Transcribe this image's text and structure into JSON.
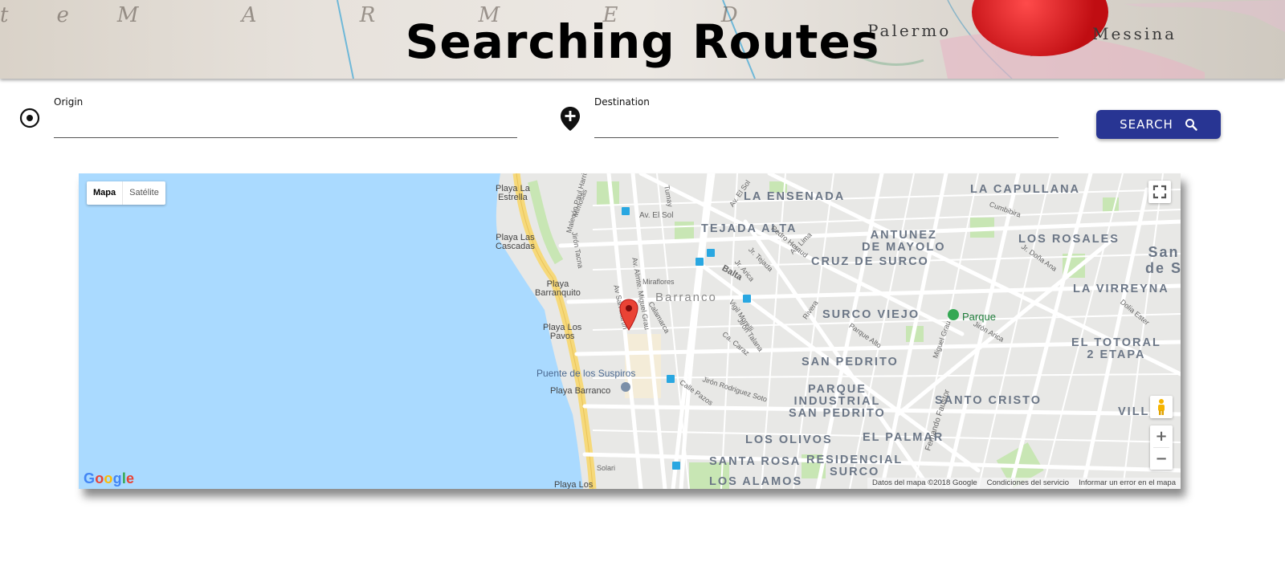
{
  "header": {
    "title": "Searching Routes",
    "faint_text": "teM A R M E D",
    "place_left": "Palermo",
    "place_right": "Messina"
  },
  "search": {
    "origin_label": "Origin",
    "origin_value": "",
    "destination_label": "Destination",
    "destination_value": "",
    "button_label": "SEARCH"
  },
  "map": {
    "type_controls": {
      "map": "Mapa",
      "satellite": "Satélite"
    },
    "districts": [
      "LA ENSENADA",
      "TEJADA ALTA",
      "ANTUNEZ\nDE MAYOLO",
      "CRUZ DE SURCO",
      "LA CAPULLANA",
      "LOS ROSALES",
      "LA VIRREYNA",
      "SURCO VIEJO",
      "SAN PEDRITO",
      "PARQUE\nINDUSTRIAL\nSAN PEDRITO",
      "SANTO CRISTO",
      "EL TOTORAL\n2 ETAPA",
      "LOS OLIVOS",
      "EL PALMAR",
      "SANTA ROSA",
      "RESIDENCIAL\nSURCO",
      "LOS ALAMOS",
      "VILLA",
      "San\nde S"
    ],
    "beaches": [
      "Playa La\nEstrella",
      "Playa Las\nCascadas",
      "Playa\nBarranquito",
      "Playa Los\nPavos",
      "Playa Barranco",
      "Playa Los"
    ],
    "streets": [
      "Av. El Sol",
      "Jirón Tacna",
      "Av San Martin",
      "Av. Almte. Miguel Grau",
      "Calamarca",
      "Miraflores",
      "Balta",
      "Pedro Heraud",
      "Av. Lima",
      "Jr. Tejada",
      "Jr. Arica",
      "Rivera",
      "Vigil Morelli",
      "Jirón Talana",
      "Ca. Caraz",
      "Parque Alto",
      "Miguel Grau",
      "Fernando Faustor",
      "Jirón Arica",
      "Calle Pazos",
      "Jirón Rodriguez Soto",
      "Solari",
      "Tumay",
      "Jr. Doña Ana",
      "Cumbibira",
      "Av. El Sol",
      "Malecón Paul Harris",
      "Mimosas",
      "Dolia Ester"
    ],
    "barranco": "Barranco",
    "parque": "Parque",
    "suspiros": "Puente de los Suspiros",
    "google": "Google",
    "attribution": [
      "Datos del mapa ©2018 Google",
      "Condiciones del servicio",
      "Informar un error en el mapa"
    ],
    "icons": {
      "fullscreen": "fullscreen-icon",
      "pegman": "pegman-icon",
      "marker": "map-marker-icon"
    }
  },
  "colors": {
    "button": "#283593",
    "water": "#aadaff",
    "marker": "#ea4335"
  }
}
